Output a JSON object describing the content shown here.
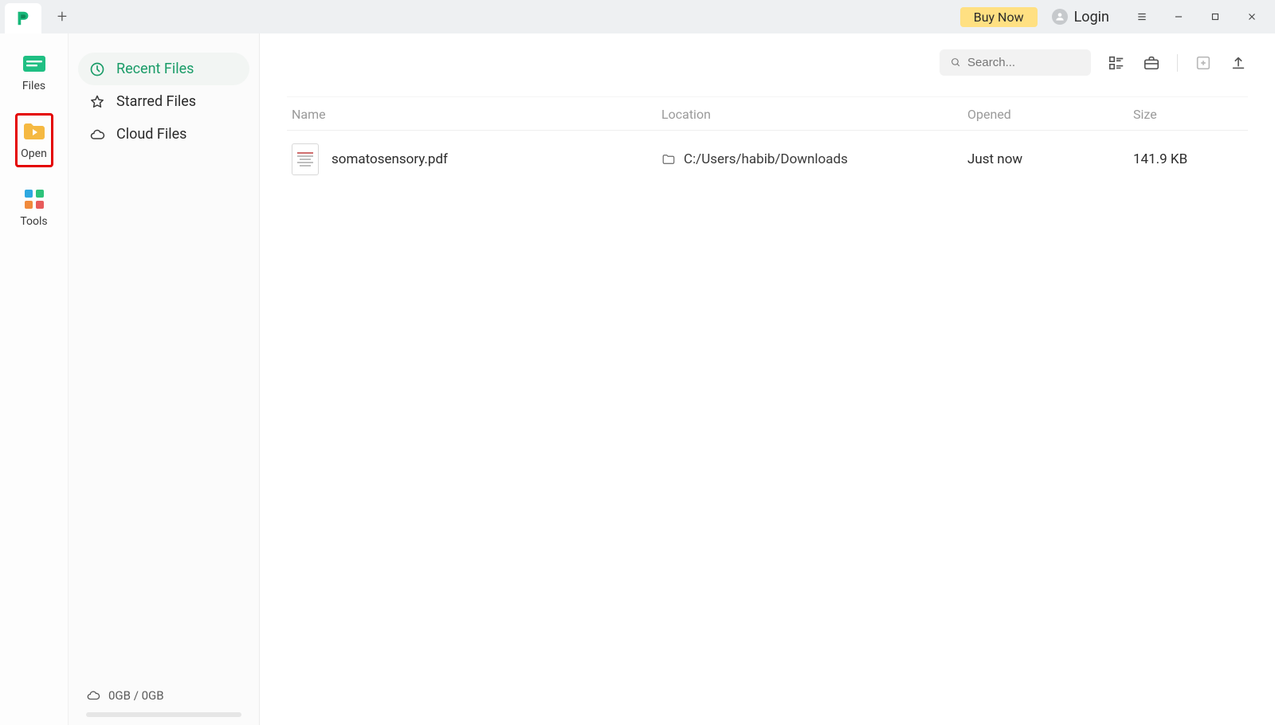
{
  "titlebar": {
    "buy_label": "Buy Now",
    "login_label": "Login"
  },
  "rail": {
    "items": [
      {
        "label": "Files"
      },
      {
        "label": "Open"
      },
      {
        "label": "Tools"
      }
    ]
  },
  "sidebar": {
    "items": [
      {
        "label": "Recent Files"
      },
      {
        "label": "Starred Files"
      },
      {
        "label": "Cloud Files"
      }
    ],
    "storage_text": "0GB / 0GB"
  },
  "toolbar": {
    "search_placeholder": "Search..."
  },
  "table": {
    "headers": {
      "name": "Name",
      "location": "Location",
      "opened": "Opened",
      "size": "Size"
    },
    "rows": [
      {
        "name": "somatosensory.pdf",
        "location": "C:/Users/habib/Downloads",
        "opened": "Just now",
        "size": "141.9 KB"
      }
    ]
  }
}
